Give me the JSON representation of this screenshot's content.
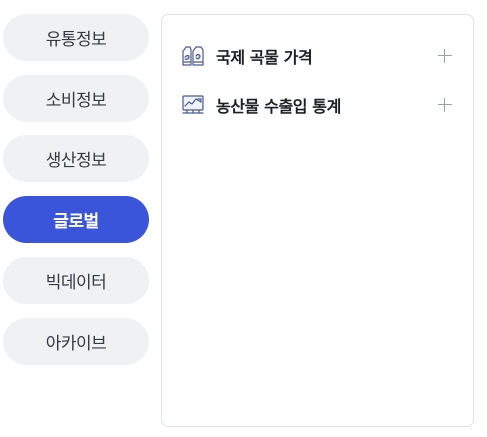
{
  "side_menu": {
    "items": [
      {
        "label": "유통정보",
        "active": false
      },
      {
        "label": "소비정보",
        "active": false
      },
      {
        "label": "생산정보",
        "active": false
      },
      {
        "label": "글로벌",
        "active": true
      },
      {
        "label": "빅데이터",
        "active": false
      },
      {
        "label": "아카이브",
        "active": false
      }
    ]
  },
  "panel": {
    "items": [
      {
        "label": "국제 곡물 가격",
        "icon": "grain-bag-icon",
        "action_icon": "plus-icon"
      },
      {
        "label": "농산물 수출입 통계",
        "icon": "trend-chart-icon",
        "action_icon": "plus-icon"
      }
    ]
  },
  "colors": {
    "accent": "#3a55d9",
    "pill_bg": "#f0f1f3",
    "icon_stroke": "#4a5a8a"
  }
}
